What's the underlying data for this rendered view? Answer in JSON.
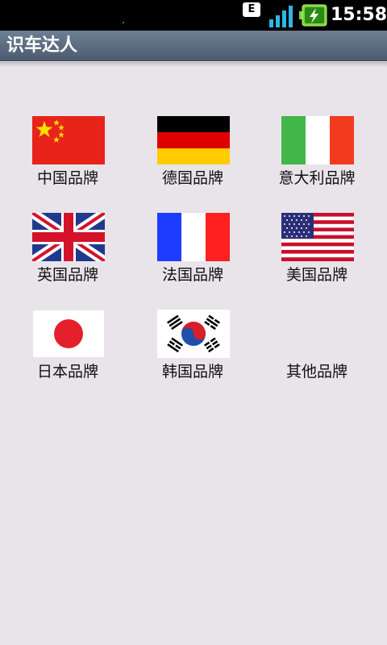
{
  "status_bar": {
    "network_badge": "E",
    "time": "15:58"
  },
  "app": {
    "title": "识车达人"
  },
  "brands": [
    {
      "label": "中国品牌",
      "flag": "china-flag-icon"
    },
    {
      "label": "德国品牌",
      "flag": "germany-flag-icon"
    },
    {
      "label": "意大利品牌",
      "flag": "italy-flag-icon"
    },
    {
      "label": "英国品牌",
      "flag": "uk-flag-icon"
    },
    {
      "label": "法国品牌",
      "flag": "france-flag-icon"
    },
    {
      "label": "美国品牌",
      "flag": "usa-flag-icon"
    },
    {
      "label": "日本品牌",
      "flag": "japan-flag-icon"
    },
    {
      "label": "韩国品牌",
      "flag": "korea-flag-icon"
    },
    {
      "label": "其他品牌",
      "flag": ""
    }
  ],
  "colors": {
    "background": "#e8e4e9",
    "title_bar": "#5b6a7e"
  }
}
